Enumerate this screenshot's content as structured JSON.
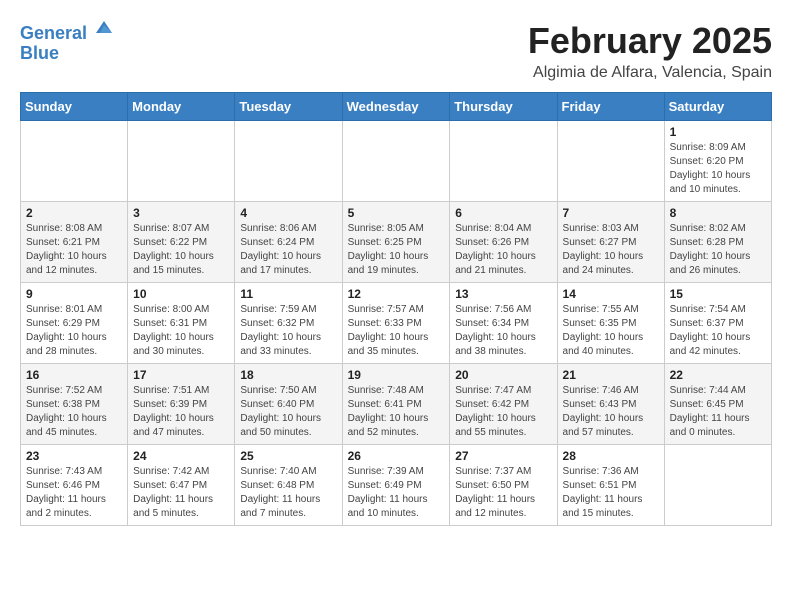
{
  "header": {
    "logo_line1": "General",
    "logo_line2": "Blue",
    "title": "February 2025",
    "subtitle": "Algimia de Alfara, Valencia, Spain"
  },
  "days_of_week": [
    "Sunday",
    "Monday",
    "Tuesday",
    "Wednesday",
    "Thursday",
    "Friday",
    "Saturday"
  ],
  "weeks": [
    [
      {
        "day": "",
        "info": ""
      },
      {
        "day": "",
        "info": ""
      },
      {
        "day": "",
        "info": ""
      },
      {
        "day": "",
        "info": ""
      },
      {
        "day": "",
        "info": ""
      },
      {
        "day": "",
        "info": ""
      },
      {
        "day": "1",
        "info": "Sunrise: 8:09 AM\nSunset: 6:20 PM\nDaylight: 10 hours and 10 minutes."
      }
    ],
    [
      {
        "day": "2",
        "info": "Sunrise: 8:08 AM\nSunset: 6:21 PM\nDaylight: 10 hours and 12 minutes."
      },
      {
        "day": "3",
        "info": "Sunrise: 8:07 AM\nSunset: 6:22 PM\nDaylight: 10 hours and 15 minutes."
      },
      {
        "day": "4",
        "info": "Sunrise: 8:06 AM\nSunset: 6:24 PM\nDaylight: 10 hours and 17 minutes."
      },
      {
        "day": "5",
        "info": "Sunrise: 8:05 AM\nSunset: 6:25 PM\nDaylight: 10 hours and 19 minutes."
      },
      {
        "day": "6",
        "info": "Sunrise: 8:04 AM\nSunset: 6:26 PM\nDaylight: 10 hours and 21 minutes."
      },
      {
        "day": "7",
        "info": "Sunrise: 8:03 AM\nSunset: 6:27 PM\nDaylight: 10 hours and 24 minutes."
      },
      {
        "day": "8",
        "info": "Sunrise: 8:02 AM\nSunset: 6:28 PM\nDaylight: 10 hours and 26 minutes."
      }
    ],
    [
      {
        "day": "9",
        "info": "Sunrise: 8:01 AM\nSunset: 6:29 PM\nDaylight: 10 hours and 28 minutes."
      },
      {
        "day": "10",
        "info": "Sunrise: 8:00 AM\nSunset: 6:31 PM\nDaylight: 10 hours and 30 minutes."
      },
      {
        "day": "11",
        "info": "Sunrise: 7:59 AM\nSunset: 6:32 PM\nDaylight: 10 hours and 33 minutes."
      },
      {
        "day": "12",
        "info": "Sunrise: 7:57 AM\nSunset: 6:33 PM\nDaylight: 10 hours and 35 minutes."
      },
      {
        "day": "13",
        "info": "Sunrise: 7:56 AM\nSunset: 6:34 PM\nDaylight: 10 hours and 38 minutes."
      },
      {
        "day": "14",
        "info": "Sunrise: 7:55 AM\nSunset: 6:35 PM\nDaylight: 10 hours and 40 minutes."
      },
      {
        "day": "15",
        "info": "Sunrise: 7:54 AM\nSunset: 6:37 PM\nDaylight: 10 hours and 42 minutes."
      }
    ],
    [
      {
        "day": "16",
        "info": "Sunrise: 7:52 AM\nSunset: 6:38 PM\nDaylight: 10 hours and 45 minutes."
      },
      {
        "day": "17",
        "info": "Sunrise: 7:51 AM\nSunset: 6:39 PM\nDaylight: 10 hours and 47 minutes."
      },
      {
        "day": "18",
        "info": "Sunrise: 7:50 AM\nSunset: 6:40 PM\nDaylight: 10 hours and 50 minutes."
      },
      {
        "day": "19",
        "info": "Sunrise: 7:48 AM\nSunset: 6:41 PM\nDaylight: 10 hours and 52 minutes."
      },
      {
        "day": "20",
        "info": "Sunrise: 7:47 AM\nSunset: 6:42 PM\nDaylight: 10 hours and 55 minutes."
      },
      {
        "day": "21",
        "info": "Sunrise: 7:46 AM\nSunset: 6:43 PM\nDaylight: 10 hours and 57 minutes."
      },
      {
        "day": "22",
        "info": "Sunrise: 7:44 AM\nSunset: 6:45 PM\nDaylight: 11 hours and 0 minutes."
      }
    ],
    [
      {
        "day": "23",
        "info": "Sunrise: 7:43 AM\nSunset: 6:46 PM\nDaylight: 11 hours and 2 minutes."
      },
      {
        "day": "24",
        "info": "Sunrise: 7:42 AM\nSunset: 6:47 PM\nDaylight: 11 hours and 5 minutes."
      },
      {
        "day": "25",
        "info": "Sunrise: 7:40 AM\nSunset: 6:48 PM\nDaylight: 11 hours and 7 minutes."
      },
      {
        "day": "26",
        "info": "Sunrise: 7:39 AM\nSunset: 6:49 PM\nDaylight: 11 hours and 10 minutes."
      },
      {
        "day": "27",
        "info": "Sunrise: 7:37 AM\nSunset: 6:50 PM\nDaylight: 11 hours and 12 minutes."
      },
      {
        "day": "28",
        "info": "Sunrise: 7:36 AM\nSunset: 6:51 PM\nDaylight: 11 hours and 15 minutes."
      },
      {
        "day": "",
        "info": ""
      }
    ]
  ]
}
